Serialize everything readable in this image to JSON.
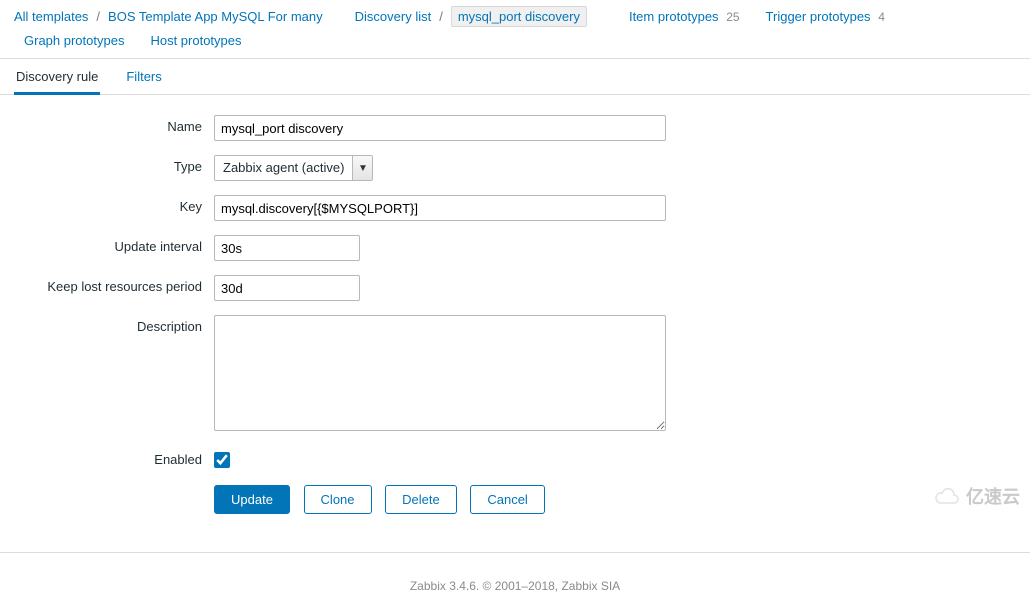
{
  "breadcrumbs": {
    "b1": {
      "label": "All templates"
    },
    "b2": {
      "label": "BOS Template App MySQL For many"
    },
    "b3": {
      "label": "Discovery list"
    },
    "b4": {
      "label": "mysql_port discovery"
    }
  },
  "topnav": {
    "item_prototypes": {
      "label": "Item prototypes",
      "count": "25"
    },
    "trigger_prototypes": {
      "label": "Trigger prototypes",
      "count": "4"
    },
    "graph_prototypes": {
      "label": "Graph prototypes"
    },
    "host_prototypes": {
      "label": "Host prototypes"
    }
  },
  "tabs": {
    "discovery_rule": "Discovery rule",
    "filters": "Filters"
  },
  "form": {
    "labels": {
      "name": "Name",
      "type": "Type",
      "key": "Key",
      "update_interval": "Update interval",
      "keep_lost": "Keep lost resources period",
      "description": "Description",
      "enabled": "Enabled"
    },
    "values": {
      "name": "mysql_port discovery",
      "type_selected": "Zabbix agent (active)",
      "key": "mysql.discovery[{$MYSQLPORT}]",
      "update_interval": "30s",
      "keep_lost": "30d",
      "description": "",
      "enabled": true
    }
  },
  "buttons": {
    "update": "Update",
    "clone": "Clone",
    "delete": "Delete",
    "cancel": "Cancel"
  },
  "footer": "Zabbix 3.4.6. © 2001–2018, Zabbix SIA",
  "watermark": "亿速云"
}
